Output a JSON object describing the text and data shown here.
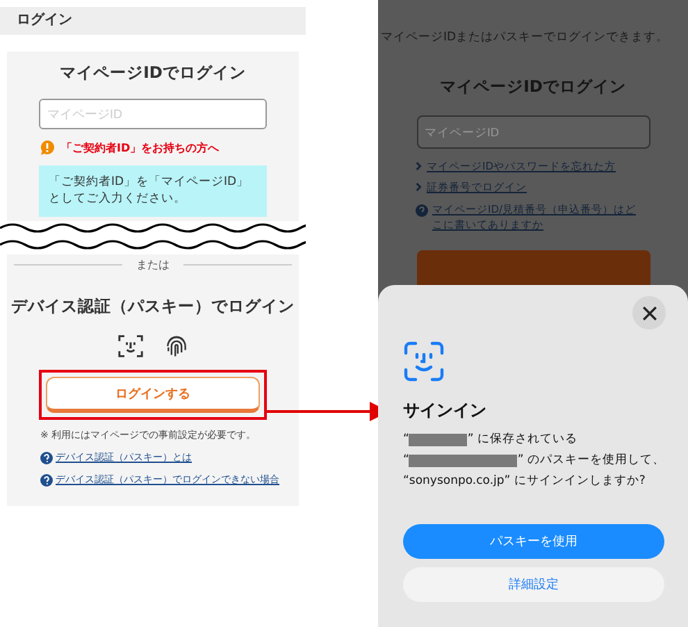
{
  "left_panel": {
    "header": "ログイン",
    "id_login": {
      "title": "マイページIDでログイン",
      "id_field": {
        "placeholder": "マイページID"
      },
      "notice": "「ご契約者ID」をお持ちの方へ",
      "info": "「ご契約者ID」を「マイページID」としてご入力ください。"
    },
    "separator": "または",
    "passkey_login": {
      "title": "デバイス認証（パスキー）でログイン",
      "button": "ログインする",
      "highlighted": true,
      "note": "※ 利用にはマイページでの事前設定が必要です。",
      "help_links": [
        "デバイス認証（パスキー）とは",
        "デバイス認証（パスキー）でログインできない場合"
      ]
    }
  },
  "right_panel": {
    "intro": "マイページIDまたはパスキーでログインできます。",
    "title": "マイページIDでログイン",
    "id_field": {
      "placeholder": "マイページID"
    },
    "links": [
      {
        "kind": "chevron",
        "text": "マイページIDやパスワードを忘れた方"
      },
      {
        "kind": "chevron",
        "text": "証券番号でログイン"
      },
      {
        "kind": "help",
        "text": "マイページID/見積番号（申込番号）はどこに書いてありますか"
      }
    ],
    "sheet": {
      "title": "サインイン",
      "message_lines": [
        [
          {
            "kind": "text",
            "text": "“"
          },
          {
            "kind": "redaction"
          },
          {
            "kind": "text",
            "text": "” に保存されている"
          }
        ],
        [
          {
            "kind": "text",
            "text": "“"
          },
          {
            "kind": "redaction"
          },
          {
            "kind": "text",
            "text": "” のパスキーを使用して、"
          }
        ],
        [
          {
            "kind": "text",
            "text": "“sonysonpo.co.jp” にサインインしますか?"
          }
        ]
      ],
      "buttons": [
        {
          "kind": "primary",
          "label": "パスキーを使用"
        },
        {
          "kind": "secondary",
          "label": "詳細設定"
        }
      ]
    }
  }
}
